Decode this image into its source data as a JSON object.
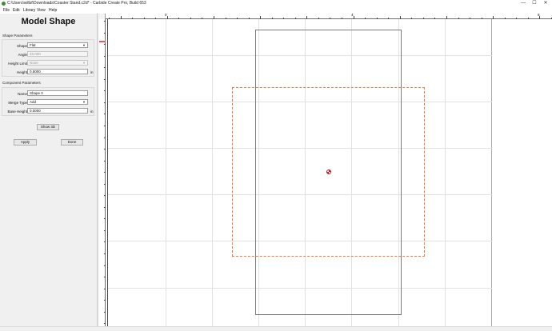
{
  "window": {
    "title": "C:\\Users\\willsf\\Downloads\\Coaster Stand.c2d* - Carbide Create Pro, Build 653",
    "icon": "carbide-create-icon",
    "controls": [
      "—",
      "☐",
      "✕"
    ]
  },
  "menu": [
    "File",
    "Edit",
    "Library",
    "View",
    "Help"
  ],
  "panel": {
    "title": "Model Shape",
    "shape_parameters": {
      "heading": "Shape Parameters",
      "shape": {
        "label": "Shape",
        "value": "Flat"
      },
      "angle": {
        "label": "Angle",
        "value": "45.000"
      },
      "height_limit": {
        "label": "Height Limit",
        "value": "None"
      },
      "height": {
        "label": "Height",
        "value": "0.5000",
        "unit": "in"
      }
    },
    "component_parameters": {
      "heading": "Component Parameters",
      "name": {
        "label": "Name",
        "value": "Shape 0"
      },
      "merge_type": {
        "label": "Merge Type",
        "value": "Add"
      },
      "base_height": {
        "label": "Base Height",
        "value": "0.0000",
        "unit": "in"
      }
    },
    "show_3d": "Show 3D",
    "apply": "Apply",
    "done": "Done"
  },
  "ruler": {
    "top_labels": [
      "0",
      "4",
      "8"
    ]
  }
}
